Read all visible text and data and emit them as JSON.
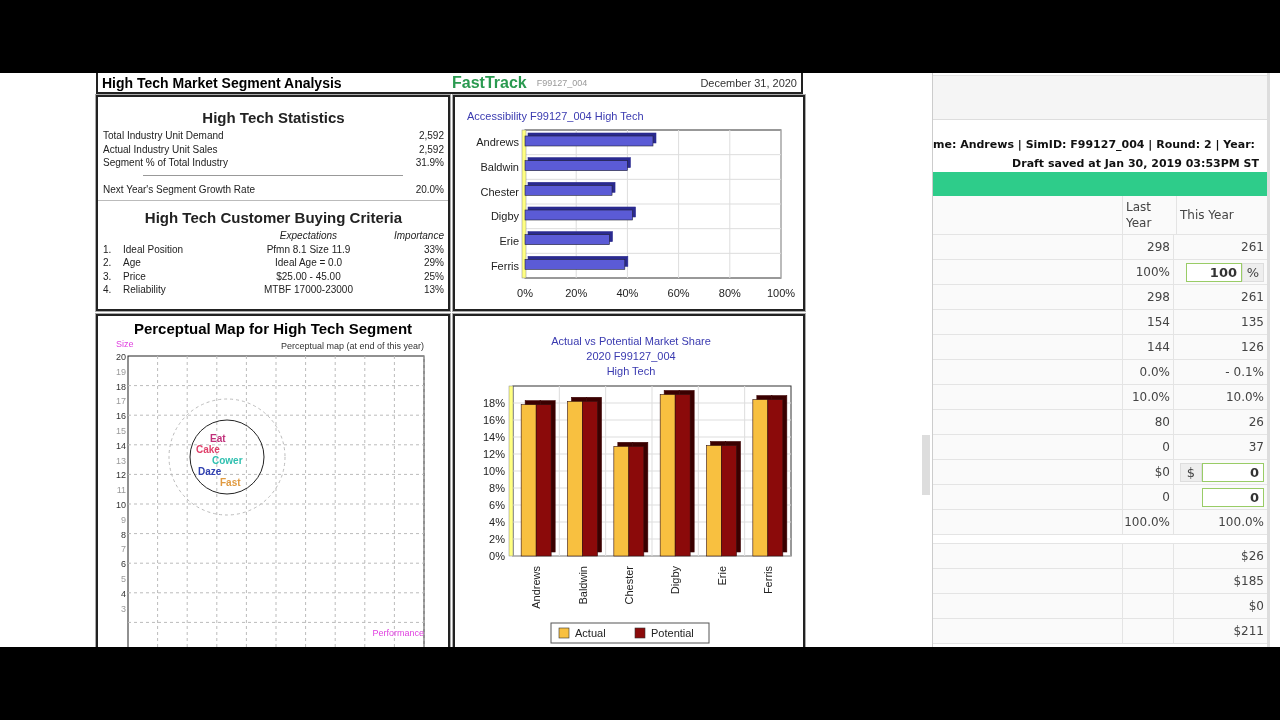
{
  "report": {
    "title": "High Tech Market Segment Analysis",
    "logo": "FastTrack",
    "sim_id": "F99127_004",
    "date": "December 31, 2020"
  },
  "statistics": {
    "title": "High Tech Statistics",
    "rows": [
      {
        "label": "Total Industry Unit Demand",
        "value": "2,592"
      },
      {
        "label": "Actual Industry Unit Sales",
        "value": "2,592"
      },
      {
        "label": "Segment % of Total Industry",
        "value": "31.9%"
      }
    ],
    "growth": {
      "label": "Next Year's Segment Growth Rate",
      "value": "20.0%"
    }
  },
  "criteria": {
    "title": "High Tech Customer Buying Criteria",
    "columns": [
      "Expectations",
      "Importance"
    ],
    "rows": [
      {
        "number": "1.",
        "label": "Ideal Position",
        "expectation": "Pfmn 8.1 Size 11.9",
        "importance": "33%"
      },
      {
        "number": "2.",
        "label": "Age",
        "expectation": "Ideal Age = 0.0",
        "importance": "29%"
      },
      {
        "number": "3.",
        "label": "Price",
        "expectation": "$25.00 - 45.00",
        "importance": "25%"
      },
      {
        "number": "4.",
        "label": "Reliability",
        "expectation": "MTBF 17000-23000",
        "importance": "13%"
      }
    ]
  },
  "accessibility": {
    "chart_data": {
      "type": "bar",
      "orientation": "horizontal",
      "title": "Accessibility F99127_004 High Tech",
      "categories": [
        "Andrews",
        "Baldwin",
        "Chester",
        "Digby",
        "Erie",
        "Ferris"
      ],
      "series": [
        {
          "color": "#5b5bd6",
          "values": [
            50,
            40,
            34,
            42,
            33,
            39
          ]
        }
      ],
      "grid": true,
      "xlim": [
        0,
        100
      ],
      "xticks": [
        {
          "value": 0,
          "label": "0%"
        },
        {
          "value": 20,
          "label": "20%"
        },
        {
          "value": 40,
          "label": "40%"
        },
        {
          "value": 60,
          "label": "60%"
        },
        {
          "value": 80,
          "label": "80%"
        },
        {
          "value": 100,
          "label": "100%"
        }
      ]
    }
  },
  "perceptual_map": {
    "title": "Perceptual Map for High Tech Segment",
    "subtitle": "Perceptual map (at end of this year)",
    "y_axis_label": "Size",
    "x_axis_label": "Performance",
    "y_ticks": [
      {
        "label": "20",
        "faint": false
      },
      {
        "label": "19",
        "faint": true
      },
      {
        "label": "18",
        "faint": false
      },
      {
        "label": "17",
        "faint": true
      },
      {
        "label": "16",
        "faint": false
      },
      {
        "label": "15",
        "faint": true
      },
      {
        "label": "14",
        "faint": false
      },
      {
        "label": "13",
        "faint": true
      },
      {
        "label": "12",
        "faint": false
      },
      {
        "label": "11",
        "faint": true
      },
      {
        "label": "10",
        "faint": false
      },
      {
        "label": "9",
        "faint": true
      },
      {
        "label": "8",
        "faint": false
      },
      {
        "label": "7",
        "faint": true
      },
      {
        "label": "6",
        "faint": false
      },
      {
        "label": "5",
        "faint": true
      },
      {
        "label": "4",
        "faint": false
      },
      {
        "label": "3",
        "faint": true
      }
    ],
    "products": [
      {
        "name": "Eat",
        "color": "#c0307a"
      },
      {
        "name": "Cake",
        "color": "#e0406a"
      },
      {
        "name": "Cower",
        "color": "#30c0b0"
      },
      {
        "name": "Daze",
        "color": "#3040b0"
      },
      {
        "name": "Fast",
        "color": "#e09a40"
      }
    ]
  },
  "market_share": {
    "chart_data": {
      "type": "bar",
      "title": "Actual vs Potential Market Share\n2020 F99127_004\nHigh Tech",
      "categories": [
        "Andrews",
        "Baldwin",
        "Chester",
        "Digby",
        "Erie",
        "Ferris"
      ],
      "series": [
        {
          "name": "Actual",
          "color": "#f8c040",
          "values": [
            17.8,
            18.2,
            12.9,
            19.0,
            13.0,
            18.4
          ]
        },
        {
          "name": "Potential",
          "color": "#8b0a0a",
          "values": [
            17.8,
            18.2,
            12.9,
            19.0,
            13.0,
            18.4
          ]
        }
      ],
      "grid": true,
      "legend": true,
      "ylim": [
        0,
        20
      ],
      "yticks": [
        {
          "value": 0,
          "label": "0%"
        },
        {
          "value": 2,
          "label": "2%"
        },
        {
          "value": 4,
          "label": "4%"
        },
        {
          "value": 6,
          "label": "6%"
        },
        {
          "value": 8,
          "label": "8%"
        },
        {
          "value": 10,
          "label": "10%"
        },
        {
          "value": 12,
          "label": "12%"
        },
        {
          "value": 14,
          "label": "14%"
        },
        {
          "value": 16,
          "label": "16%"
        },
        {
          "value": 18,
          "label": "18%"
        }
      ]
    }
  },
  "side_panel": {
    "session": "me: Andrews | SimID: F99127_004 | Round: 2 | Year:",
    "draft": "Draft saved at Jan 30, 2019 03:53PM ST",
    "columns": [
      "Last Year",
      "This Year"
    ],
    "rows": [
      {
        "kind": "text",
        "last": "298",
        "this": "261"
      },
      {
        "kind": "percent-input",
        "last": "100%",
        "this": "100",
        "unit": "%"
      },
      {
        "kind": "text",
        "last": "298",
        "this": "261"
      },
      {
        "kind": "text",
        "last": "154",
        "this": "135"
      },
      {
        "kind": "text",
        "last": "144",
        "this": "126"
      },
      {
        "kind": "text",
        "last": "0.0%",
        "this": "- 0.1%"
      },
      {
        "kind": "text",
        "last": "10.0%",
        "this": "10.0%"
      },
      {
        "kind": "text",
        "last": "80",
        "this": "26"
      },
      {
        "kind": "text",
        "last": "0",
        "this": "37"
      },
      {
        "kind": "dollar-input",
        "last": "$0",
        "this": "0",
        "unit": "$"
      },
      {
        "kind": "input",
        "last": "0",
        "this": "0"
      },
      {
        "kind": "text",
        "last": "100.0%",
        "this": "100.0%"
      }
    ],
    "totals": [
      {
        "this": "$26"
      },
      {
        "this": "$185"
      },
      {
        "this": "$0"
      },
      {
        "this": "$211"
      }
    ]
  }
}
